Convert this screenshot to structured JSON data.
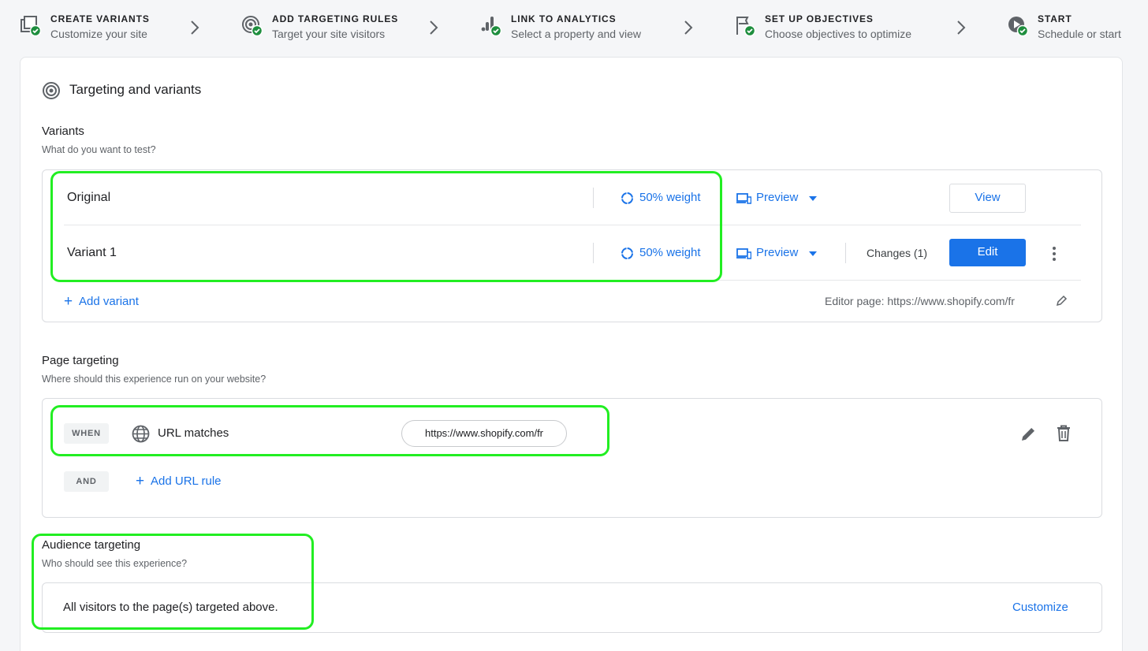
{
  "stepper": {
    "steps": [
      {
        "title": "CREATE VARIANTS",
        "subtitle": "Customize your site",
        "icon": "copy-check-icon"
      },
      {
        "title": "ADD TARGETING RULES",
        "subtitle": "Target your site visitors",
        "icon": "target-check-icon"
      },
      {
        "title": "LINK TO ANALYTICS",
        "subtitle": "Select a property and view",
        "icon": "analytics-check-icon"
      },
      {
        "title": "SET UP OBJECTIVES",
        "subtitle": "Choose objectives to optimize",
        "icon": "flag-check-icon"
      },
      {
        "title": "START",
        "subtitle": "Schedule or start",
        "icon": "play-check-icon"
      }
    ]
  },
  "card": {
    "title": "Targeting and variants",
    "variants": {
      "title": "Variants",
      "subtitle": "What do you want to test?",
      "rows": [
        {
          "name": "Original",
          "weight": "50% weight",
          "preview": "Preview",
          "action": "View"
        },
        {
          "name": "Variant 1",
          "weight": "50% weight",
          "preview": "Preview",
          "changes": "Changes (1)",
          "action": "Edit"
        }
      ],
      "add_label": "Add variant",
      "editor_page": "Editor page: https://www.shopify.com/fr"
    },
    "page_targeting": {
      "title": "Page targeting",
      "subtitle": "Where should this experience run on your website?",
      "when_chip": "WHEN",
      "rule_label": "URL matches",
      "rule_value": "https://www.shopify.com/fr",
      "and_chip": "AND",
      "add_rule_label": "Add URL rule"
    },
    "audience": {
      "title": "Audience targeting",
      "subtitle": "Who should see this experience?",
      "summary": "All visitors to the page(s) targeted above.",
      "customize_label": "Customize"
    }
  },
  "colors": {
    "accent": "#1a73e8",
    "check": "#1e8e3e",
    "highlight": "#22ee22"
  }
}
